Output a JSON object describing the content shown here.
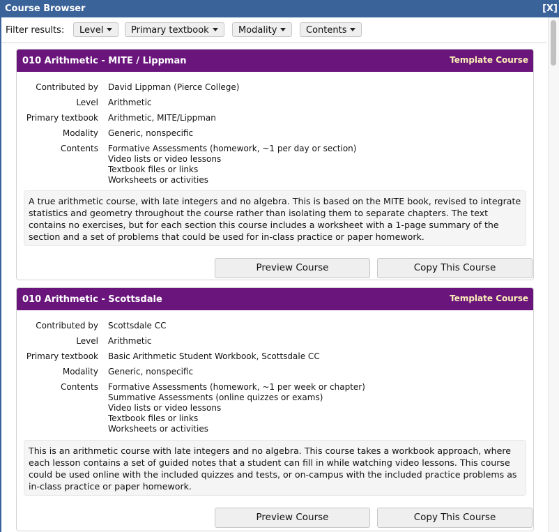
{
  "window": {
    "title": "Course Browser",
    "close_label": "[X]"
  },
  "filters": {
    "label": "Filter results:",
    "buttons": [
      {
        "label": "Level"
      },
      {
        "label": "Primary textbook"
      },
      {
        "label": "Modality"
      },
      {
        "label": "Contents"
      }
    ]
  },
  "colors": {
    "titlebar": "#3a639a",
    "card_header": "#69157c",
    "tag_text": "#fdf2b8"
  },
  "courses": [
    {
      "title": "010 Arithmetic - MITE / Lippman",
      "tag": "Template Course",
      "fields": {
        "contributed_label": "Contributed by",
        "contributed": "David Lippman (Pierce College)",
        "level_label": "Level",
        "level": "Arithmetic",
        "textbook_label": "Primary textbook",
        "textbook": "Arithmetic, MITE/Lippman",
        "modality_label": "Modality",
        "modality": "Generic, nonspecific",
        "contents_label": "Contents",
        "contents": [
          "Formative Assessments (homework, ~1 per day or section)",
          "Video lists or video lessons",
          "Textbook files or links",
          "Worksheets or activities"
        ]
      },
      "description": "A true arithmetic course, with late integers and no algebra. This is based on the MITE book, revised to integrate statistics and geometry throughout the course rather than isolating them to separate chapters. The text contains no exercises, but for each section this course includes a worksheet with a 1-page summary of the section and a set of problems that could be used for in-class practice or paper homework.",
      "preview_label": "Preview Course",
      "copy_label": "Copy This Course"
    },
    {
      "title": "010 Arithmetic - Scottsdale",
      "tag": "Template Course",
      "fields": {
        "contributed_label": "Contributed by",
        "contributed": "Scottsdale CC",
        "level_label": "Level",
        "level": "Arithmetic",
        "textbook_label": "Primary textbook",
        "textbook": "Basic Arithmetic Student Workbook, Scottsdale CC",
        "modality_label": "Modality",
        "modality": "Generic, nonspecific",
        "contents_label": "Contents",
        "contents": [
          "Formative Assessments (homework, ~1 per week or chapter)",
          "Summative Assessments (online quizzes or exams)",
          "Video lists or video lessons",
          "Textbook files or links",
          "Worksheets or activities"
        ]
      },
      "description": "This is an arithmetic course with late integers and no algebra. This course takes a workbook approach, where each lesson contains a set of guided notes that a student can fill in while watching video lessons. This course could be used online with the included quizzes and tests, or on-campus with the included practice problems as in-class practice or paper homework.",
      "preview_label": "Preview Course",
      "copy_label": "Copy This Course"
    }
  ]
}
